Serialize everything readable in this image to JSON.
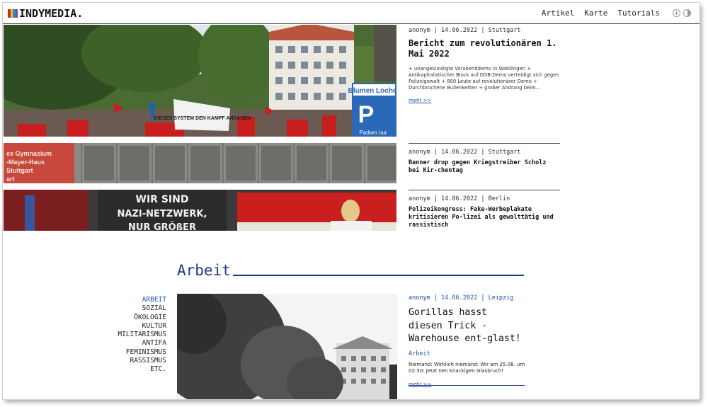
{
  "header": {
    "logo_text": "INDYMEDIA.",
    "logo_colors": [
      "#e02020",
      "#f5c400",
      "#2a8ad4",
      "#8a3bd0"
    ],
    "nav": [
      "Artikel",
      "Karte",
      "Tutorials"
    ],
    "icons": [
      "plus-circle-icon",
      "contrast-icon"
    ]
  },
  "teasers": [
    {
      "meta": "anonym | 14.06.2022 | Stuttgart",
      "title": "Bericht zum revolutionären 1. Mai 2022",
      "body": "+ unangekündigte Vorabenddemo in Waiblingen + Antikapitalistischer Block auf DGB-Demo verteidigt sich gegen Polizeigewalt + 800 Leute auf revolutionärer Demo + Durchbrochene Bullenketten + großer Andrang beim...",
      "more": "mehr >>"
    },
    {
      "meta": "anonym | 14.06.2022 | Stuttgart",
      "title": "Banner drop gegen Kriegstreiber Scholz bei Kir-chentag"
    },
    {
      "meta": "anonym | 14.06.2022 | Berlin",
      "title": "Polizeikongress: Fake-Werbeplakate kritisieren Po-lizei als gewalttätig und rassistisch"
    }
  ],
  "image_text": {
    "sign_top": "Blumen Locher",
    "sign_bottom": "Parken nur",
    "banner": "DIESES SYSTEM DEN KAMPF ANSAGEN",
    "school_line1": "es Gymnasium",
    "school_line2": "-Mayer-Haus",
    "school_line3": "Stuttgart",
    "school_line4": "art",
    "poster_line1": "WIR SIND",
    "poster_line2": "NAZI-NETZWERK,",
    "poster_line3": "NUR GRÖßER"
  },
  "section": {
    "title": "Arbeit",
    "categories": [
      "ARBEIT",
      "SOZIAL",
      "ÖKOLOGIE",
      "KULTUR",
      "MILITARISMUS",
      "ANTIFA",
      "FEMINISMUS",
      "RASSISMUS",
      "ETC."
    ],
    "active_category": "ARBEIT",
    "featured": {
      "meta": "anonym | 14.06.2022 | Leipzig",
      "title": "Gorillas hasst diesen Trick - Warehouse ent-glast!",
      "category": "Arbeit",
      "body": "Niemand: Wirklich niemand: Wir am 25.08. um 02:30: Jetzt nen knackigen Glasbruch!",
      "more": "mehr >>"
    }
  },
  "colors": {
    "accent": "#1e3a8a",
    "link": "#1e4fa8"
  }
}
